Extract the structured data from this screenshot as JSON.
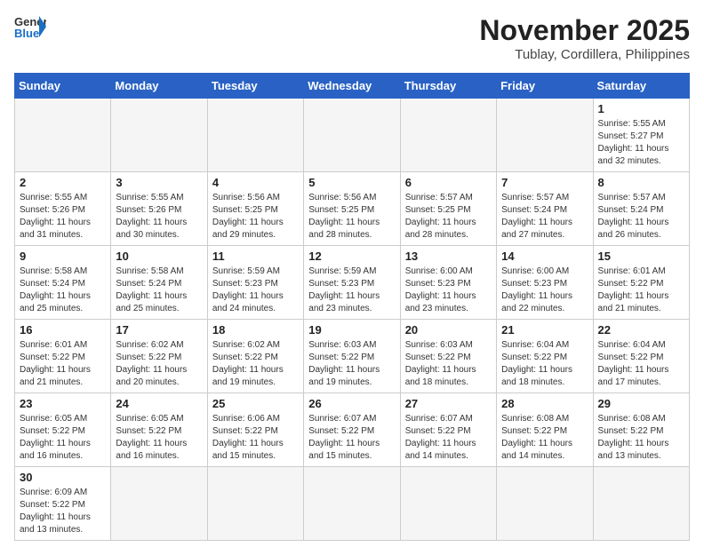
{
  "header": {
    "logo_general": "General",
    "logo_blue": "Blue",
    "month_title": "November 2025",
    "location": "Tublay, Cordillera, Philippines"
  },
  "days_of_week": [
    "Sunday",
    "Monday",
    "Tuesday",
    "Wednesday",
    "Thursday",
    "Friday",
    "Saturday"
  ],
  "weeks": [
    [
      {
        "day": "",
        "info": ""
      },
      {
        "day": "",
        "info": ""
      },
      {
        "day": "",
        "info": ""
      },
      {
        "day": "",
        "info": ""
      },
      {
        "day": "",
        "info": ""
      },
      {
        "day": "",
        "info": ""
      },
      {
        "day": "1",
        "info": "Sunrise: 5:55 AM\nSunset: 5:27 PM\nDaylight: 11 hours\nand 32 minutes."
      }
    ],
    [
      {
        "day": "2",
        "info": "Sunrise: 5:55 AM\nSunset: 5:26 PM\nDaylight: 11 hours\nand 31 minutes."
      },
      {
        "day": "3",
        "info": "Sunrise: 5:55 AM\nSunset: 5:26 PM\nDaylight: 11 hours\nand 30 minutes."
      },
      {
        "day": "4",
        "info": "Sunrise: 5:56 AM\nSunset: 5:25 PM\nDaylight: 11 hours\nand 29 minutes."
      },
      {
        "day": "5",
        "info": "Sunrise: 5:56 AM\nSunset: 5:25 PM\nDaylight: 11 hours\nand 28 minutes."
      },
      {
        "day": "6",
        "info": "Sunrise: 5:57 AM\nSunset: 5:25 PM\nDaylight: 11 hours\nand 28 minutes."
      },
      {
        "day": "7",
        "info": "Sunrise: 5:57 AM\nSunset: 5:24 PM\nDaylight: 11 hours\nand 27 minutes."
      },
      {
        "day": "8",
        "info": "Sunrise: 5:57 AM\nSunset: 5:24 PM\nDaylight: 11 hours\nand 26 minutes."
      }
    ],
    [
      {
        "day": "9",
        "info": "Sunrise: 5:58 AM\nSunset: 5:24 PM\nDaylight: 11 hours\nand 25 minutes."
      },
      {
        "day": "10",
        "info": "Sunrise: 5:58 AM\nSunset: 5:24 PM\nDaylight: 11 hours\nand 25 minutes."
      },
      {
        "day": "11",
        "info": "Sunrise: 5:59 AM\nSunset: 5:23 PM\nDaylight: 11 hours\nand 24 minutes."
      },
      {
        "day": "12",
        "info": "Sunrise: 5:59 AM\nSunset: 5:23 PM\nDaylight: 11 hours\nand 23 minutes."
      },
      {
        "day": "13",
        "info": "Sunrise: 6:00 AM\nSunset: 5:23 PM\nDaylight: 11 hours\nand 23 minutes."
      },
      {
        "day": "14",
        "info": "Sunrise: 6:00 AM\nSunset: 5:23 PM\nDaylight: 11 hours\nand 22 minutes."
      },
      {
        "day": "15",
        "info": "Sunrise: 6:01 AM\nSunset: 5:22 PM\nDaylight: 11 hours\nand 21 minutes."
      }
    ],
    [
      {
        "day": "16",
        "info": "Sunrise: 6:01 AM\nSunset: 5:22 PM\nDaylight: 11 hours\nand 21 minutes."
      },
      {
        "day": "17",
        "info": "Sunrise: 6:02 AM\nSunset: 5:22 PM\nDaylight: 11 hours\nand 20 minutes."
      },
      {
        "day": "18",
        "info": "Sunrise: 6:02 AM\nSunset: 5:22 PM\nDaylight: 11 hours\nand 19 minutes."
      },
      {
        "day": "19",
        "info": "Sunrise: 6:03 AM\nSunset: 5:22 PM\nDaylight: 11 hours\nand 19 minutes."
      },
      {
        "day": "20",
        "info": "Sunrise: 6:03 AM\nSunset: 5:22 PM\nDaylight: 11 hours\nand 18 minutes."
      },
      {
        "day": "21",
        "info": "Sunrise: 6:04 AM\nSunset: 5:22 PM\nDaylight: 11 hours\nand 18 minutes."
      },
      {
        "day": "22",
        "info": "Sunrise: 6:04 AM\nSunset: 5:22 PM\nDaylight: 11 hours\nand 17 minutes."
      }
    ],
    [
      {
        "day": "23",
        "info": "Sunrise: 6:05 AM\nSunset: 5:22 PM\nDaylight: 11 hours\nand 16 minutes."
      },
      {
        "day": "24",
        "info": "Sunrise: 6:05 AM\nSunset: 5:22 PM\nDaylight: 11 hours\nand 16 minutes."
      },
      {
        "day": "25",
        "info": "Sunrise: 6:06 AM\nSunset: 5:22 PM\nDaylight: 11 hours\nand 15 minutes."
      },
      {
        "day": "26",
        "info": "Sunrise: 6:07 AM\nSunset: 5:22 PM\nDaylight: 11 hours\nand 15 minutes."
      },
      {
        "day": "27",
        "info": "Sunrise: 6:07 AM\nSunset: 5:22 PM\nDaylight: 11 hours\nand 14 minutes."
      },
      {
        "day": "28",
        "info": "Sunrise: 6:08 AM\nSunset: 5:22 PM\nDaylight: 11 hours\nand 14 minutes."
      },
      {
        "day": "29",
        "info": "Sunrise: 6:08 AM\nSunset: 5:22 PM\nDaylight: 11 hours\nand 13 minutes."
      }
    ],
    [
      {
        "day": "30",
        "info": "Sunrise: 6:09 AM\nSunset: 5:22 PM\nDaylight: 11 hours\nand 13 minutes."
      },
      {
        "day": "",
        "info": ""
      },
      {
        "day": "",
        "info": ""
      },
      {
        "day": "",
        "info": ""
      },
      {
        "day": "",
        "info": ""
      },
      {
        "day": "",
        "info": ""
      },
      {
        "day": "",
        "info": ""
      }
    ]
  ]
}
